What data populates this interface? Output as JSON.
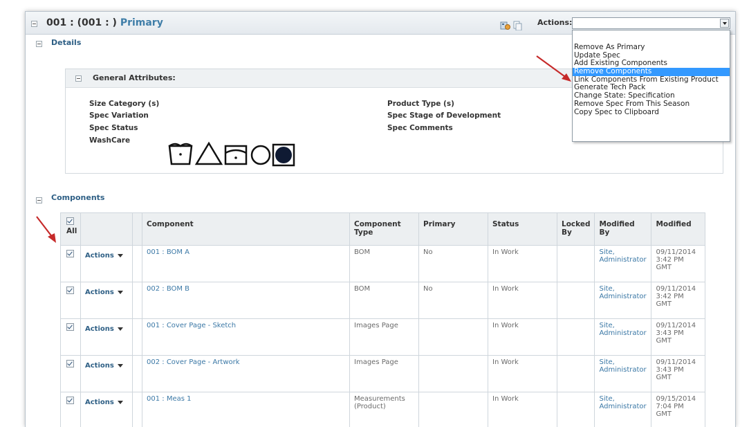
{
  "header": {
    "prefix": "001 : (001 : )",
    "primary": "Primary",
    "actions_label": "Actions:",
    "actions_value": ""
  },
  "actions_menu": {
    "items": [
      "Remove As Primary",
      "Update Spec",
      "Add Existing Components",
      "Remove Components",
      "Link Components From Existing Product",
      "Generate Tech Pack",
      "Change State: Specification",
      "Remove Spec From This Season",
      "Copy Spec to Clipboard"
    ],
    "highlighted": "Remove Components"
  },
  "details": {
    "label": "Details",
    "general_attributes": {
      "title": "General Attributes:",
      "left_fields": [
        "Size Category (s)",
        "Spec Variation",
        "Spec Status",
        "WashCare"
      ],
      "right_fields": [
        "Product Type (s)",
        "Spec Stage of Development",
        "Spec Comments"
      ]
    },
    "washcare_icons": [
      "wash-30-icon",
      "bleach-triangle-icon",
      "tumble-dry-icon",
      "dry-clean-circle-icon",
      "dry-clean-filled-icon"
    ]
  },
  "components": {
    "label": "Components",
    "columns": [
      "All",
      "",
      "",
      "Component",
      "Component Type",
      "Primary",
      "Status",
      "Locked By",
      "Modified By",
      "Modified"
    ],
    "actions_label": "Actions",
    "rows": [
      {
        "component": "001 : BOM A",
        "type": "BOM",
        "primary": "No",
        "status": "In Work",
        "locked": "",
        "modified_by": "Site, Administrator",
        "modified": "09/11/2014 3:42 PM GMT"
      },
      {
        "component": "002 : BOM B",
        "type": "BOM",
        "primary": "No",
        "status": "In Work",
        "locked": "",
        "modified_by": "Site, Administrator",
        "modified": "09/11/2014 3:42 PM GMT"
      },
      {
        "component": "001 : Cover Page - Sketch",
        "type": "Images Page",
        "primary": "",
        "status": "In Work",
        "locked": "",
        "modified_by": "Site, Administrator",
        "modified": "09/11/2014 3:43 PM GMT"
      },
      {
        "component": "002 : Cover Page - Artwork",
        "type": "Images Page",
        "primary": "",
        "status": "In Work",
        "locked": "",
        "modified_by": "Site, Administrator",
        "modified": "09/11/2014 3:43 PM GMT"
      },
      {
        "component": "001 : Meas 1",
        "type": "Measurements (Product)",
        "primary": "",
        "status": "In Work",
        "locked": "",
        "modified_by": "Site, Administrator",
        "modified": "09/15/2014 7:04 PM GMT"
      }
    ]
  },
  "colors": {
    "accent": "#3f7ea8",
    "menu_highlight": "#3399ff",
    "arrow": "#c62a2a"
  }
}
